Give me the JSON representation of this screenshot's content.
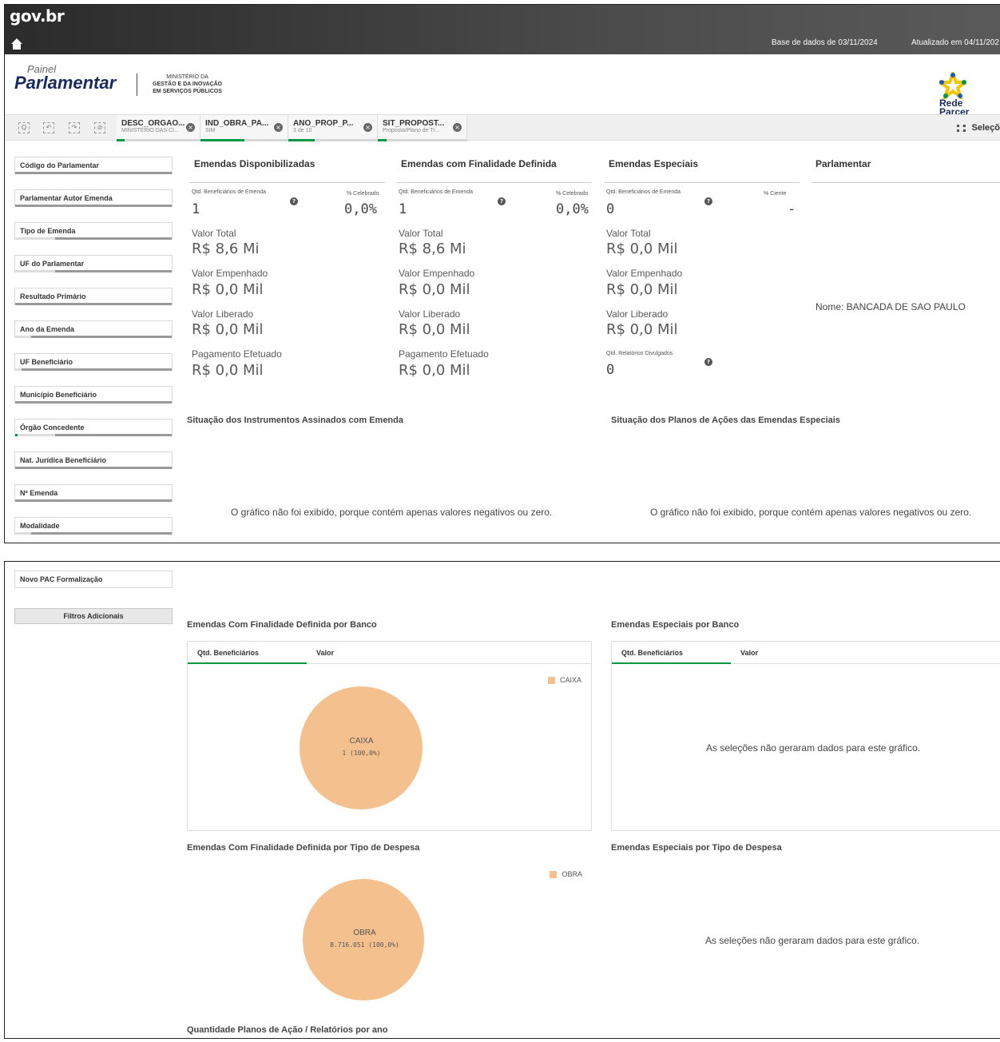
{
  "header": {
    "gov_logo": "gov.br",
    "database_date": "Base de dados de 03/11/2024",
    "updated_date": "Atualizado em 04/11/202",
    "painel_small": "Painel",
    "painel_big": "Parlamentar",
    "ministerio_line1": "MINISTÉRIO DA",
    "ministerio_line2": "GESTÃO E DA INOVAÇÃO",
    "ministerio_line3": "EM SERVIÇOS PÚBLICOS",
    "rede_line1": "Rede",
    "rede_line2": "Parcer"
  },
  "toolbar": {
    "chips": [
      {
        "title": "DESC_ORGAO...",
        "subtitle": "MINISTÉRIO DAS CI...",
        "selected_fraction": 0.1
      },
      {
        "title": "IND_OBRA_PA...",
        "subtitle": "SIM",
        "selected_fraction": 0.5
      },
      {
        "title": "ANO_PROP_P...",
        "subtitle": "3 de 10",
        "selected_fraction": 0.3
      },
      {
        "title": "SIT_PROPOST...",
        "subtitle": "Proposta/Plano de Tr...",
        "selected_fraction": 0.1
      }
    ],
    "selections_label": "Seleçõ"
  },
  "filters": [
    "Código do Parlamentar",
    "Parlamentar Autor Emenda",
    "Tipo de Emenda",
    "UF do Parlamentar",
    "Resultado Primário",
    "Ano da Emenda",
    "UF Beneficiário",
    "Município Beneficiário",
    "Órgão Concedente",
    "Nat. Jurídica Beneficiário",
    "Nº Emenda",
    "Modalidade"
  ],
  "filters_bottom": [
    "Novo PAC Formalização"
  ],
  "filters_button": "Filtros Adicionais",
  "kpis": {
    "disponibilizadas": {
      "title": "Emendas Disponibilizadas",
      "qtd_label": "Qtd. Beneficiários de Emenda",
      "qtd_value": "1",
      "pct_label": "% Celebrado",
      "pct_value": "0,0%",
      "valor_total_label": "Valor Total",
      "valor_total": "R$ 8,6 Mi",
      "valor_empenhado_label": "Valor Empenhado",
      "valor_empenhado": "R$ 0,0 Mil",
      "valor_liberado_label": "Valor Liberado",
      "valor_liberado": "R$ 0,0 Mil",
      "pagamento_label": "Pagamento Efetuado",
      "pagamento": "R$ 0,0 Mil"
    },
    "finalidade": {
      "title": "Emendas com Finalidade Definida",
      "qtd_label": "Qtd. Beneficiários de Emenda",
      "qtd_value": "1",
      "pct_label": "% Celebrado",
      "pct_value": "0,0%",
      "valor_total_label": "Valor Total",
      "valor_total": "R$ 8,6 Mi",
      "valor_empenhado_label": "Valor Empenhado",
      "valor_empenhado": "R$ 0,0 Mil",
      "valor_liberado_label": "Valor Liberado",
      "valor_liberado": "R$ 0,0 Mil",
      "pagamento_label": "Pagamento Efetuado",
      "pagamento": "R$ 0,0 Mil"
    },
    "especiais": {
      "title": "Emendas Especiais",
      "qtd_label": "Qtd. Beneficiários de Emenda",
      "qtd_value": "0",
      "pct_label": "% Ciente",
      "pct_value": "-",
      "valor_total_label": "Valor Total",
      "valor_total": "R$ 0,0 Mil",
      "valor_empenhado_label": "Valor Empenhado",
      "valor_empenhado": "R$ 0,0 Mil",
      "valor_liberado_label": "Valor Liberado",
      "valor_liberado": "R$ 0,0 Mil",
      "relatorios_label": "Qtd. Relatórios Divulgados",
      "relatorios_value": "0"
    },
    "parlamentar": {
      "title": "Parlamentar",
      "nome": "Nome: BANCADA DE SAO PAULO"
    }
  },
  "sections": {
    "instrumentos_title": "Situação dos Instrumentos Assinados com Emenda",
    "planos_title": "Situação dos Planos de Ações das Emendas Especiais",
    "no_chart_msg": "O gráfico não foi exibido, porque contém apenas valores negativos ou zero.",
    "banco_fin_title": "Emendas Com Finalidade Definida por Banco",
    "banco_esp_title": "Emendas Especiais por Banco",
    "despesa_fin_title": "Emendas Com Finalidade Definida por Tipo de Despesa",
    "despesa_esp_title": "Emendas Especiais por Tipo de Despesa",
    "planos_ano_title": "Quantidade Planos de Ação / Relatórios por ano",
    "no_data_msg": "As seleções não geraram dados para este gráfico.",
    "tab_qtd": "Qtd. Beneficiários",
    "tab_valor": "Valor"
  },
  "chart_data": [
    {
      "type": "pie",
      "categories": [
        "CAIXA"
      ],
      "values": [
        1
      ],
      "data_labels": [
        "1 (100,0%)"
      ],
      "legend": "top-right",
      "colors": [
        "#f3c08e"
      ]
    },
    {
      "type": "pie",
      "categories": [
        "OBRA"
      ],
      "values": [
        8716051
      ],
      "data_labels": [
        "8.716.051 (100,0%)"
      ],
      "legend": "top-right",
      "colors": [
        "#f3c08e"
      ]
    }
  ]
}
